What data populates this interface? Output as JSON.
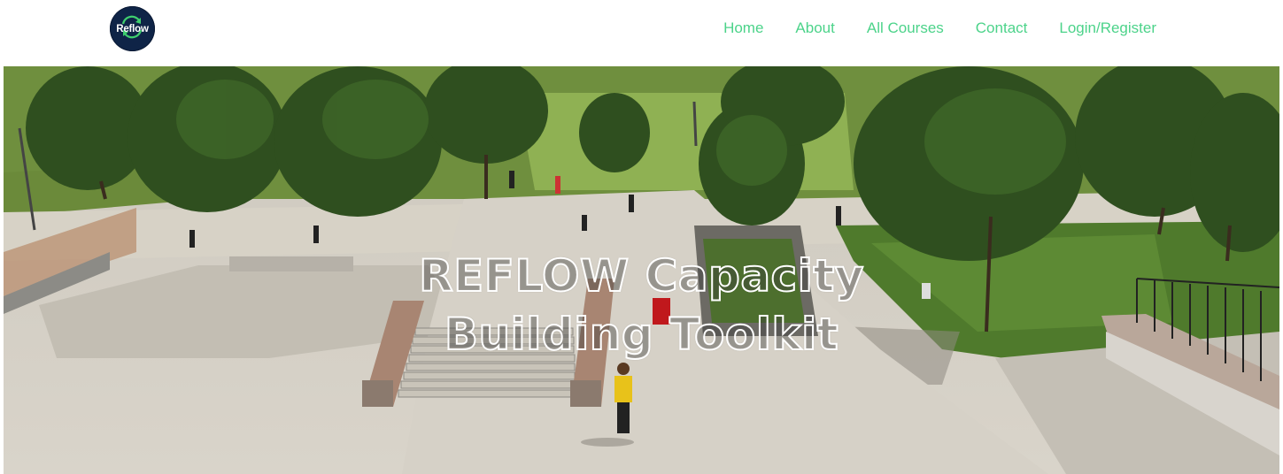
{
  "header": {
    "logo_text": "Reflow",
    "nav": [
      {
        "label": "Home"
      },
      {
        "label": "About"
      },
      {
        "label": "All Courses"
      },
      {
        "label": "Contact"
      },
      {
        "label": "Login/Register"
      }
    ]
  },
  "hero": {
    "title_line1": "REFLOW Capacity",
    "title_line2": "Building Toolkit"
  },
  "colors": {
    "nav_link": "#4cd38a",
    "logo_bg": "#0f2447",
    "logo_accent": "#3fcf6e"
  }
}
